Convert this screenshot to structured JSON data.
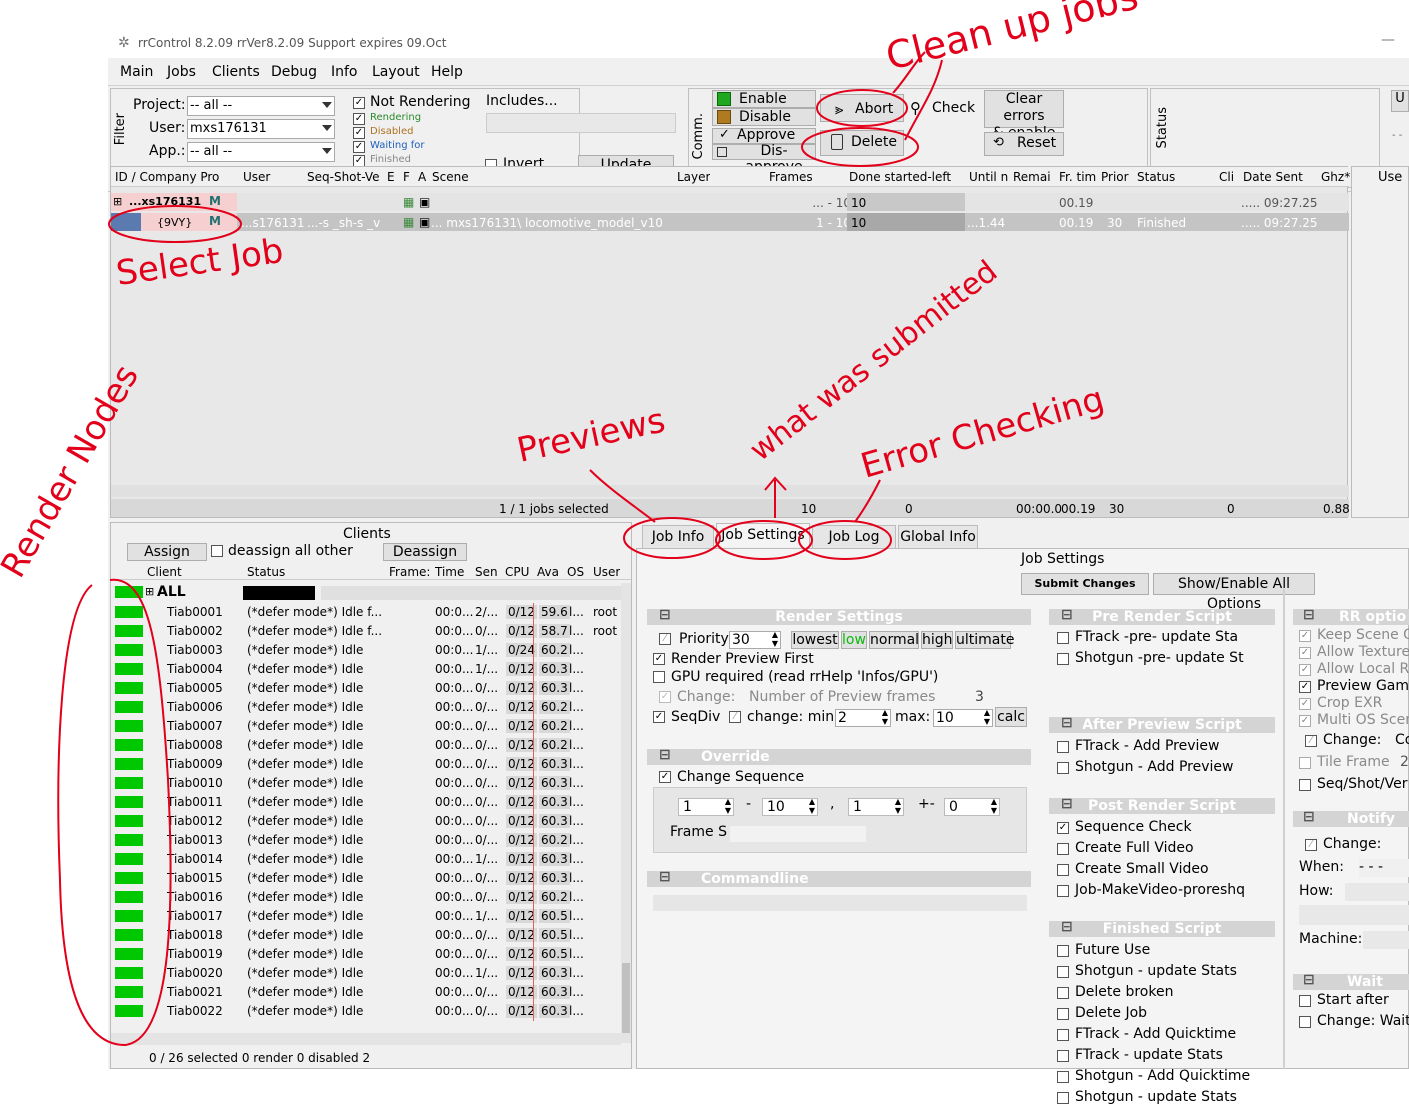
{
  "window": {
    "title": "rrControl 8.2.09    rrVer8.2.09    Support expires 09.Oct",
    "minimize": "—"
  },
  "menu": [
    "Main",
    "Jobs",
    "Clients",
    "Debug",
    "Info",
    "Layout",
    "Help"
  ],
  "filter": {
    "tab_label": "Filter",
    "project_label": "Project:",
    "project_value": "-- all --",
    "user_label": "User:",
    "user_value": "mxs176131",
    "app_label": "App.:",
    "app_value": "-- all --",
    "states": [
      "Not Rendering",
      "Rendering",
      "Disabled",
      "Waiting for",
      "Finished"
    ],
    "includes_label": "Includes...",
    "invert_label": "Invert",
    "update_label": "Update"
  },
  "commands": {
    "tab_label": "Comm.",
    "enable": "Enable",
    "disable": "Disable",
    "approve": "Approve",
    "disapprove": "Dis-approve",
    "abort": "Abort",
    "delete": "Delete",
    "check": "Check",
    "clear_errors": "Clear errors",
    "and_enable": "& enable",
    "reset": "Reset",
    "status_tab": "Status",
    "right_u": "U",
    "right_dots": "- -"
  },
  "jobs_table": {
    "headers": [
      "ID / Company Pro",
      "User",
      "Seq-Shot-Ve",
      "E",
      "F",
      "A",
      "Scene",
      "Layer",
      "Frames",
      "Done started-left",
      "Until n",
      "Remai",
      "Fr. tim",
      "Prior",
      "Status",
      "Cli",
      "Date Sent",
      "Ghz*"
    ],
    "right_header": "Use",
    "rows": [
      {
        "id": "...xs176131",
        "user": "",
        "seq": "",
        "scene": "",
        "frames": "... -   10",
        "done": "10",
        "until": "",
        "remain": "",
        "frtime": "00.19",
        "prior": "",
        "status": "",
        "date": "..... 09:27.25"
      },
      {
        "id": "{9VY}",
        "user": "...s176131",
        "seq": "...-s _sh-s _v",
        "scene": "...    mxs176131\\    locomotive_model_v10",
        "frames": "1 -   10",
        "done": "10",
        "until": "...1.44",
        "remain": "",
        "frtime": "00.19",
        "prior": "30",
        "status": "Finished",
        "date": "..... 09:27.25"
      }
    ],
    "footer": {
      "selected": "1 / 1 jobs selected",
      "frames": "10",
      "done": "0",
      "until": "00:00.0",
      "frtime": "00.19",
      "prior": "30",
      "cli": "0",
      "ghz": "0.88"
    }
  },
  "clients": {
    "title": "Clients",
    "assign": "Assign",
    "deassign_all": "deassign all other",
    "deassign": "Deassign",
    "headers": [
      "Client",
      "Status",
      "Frame:",
      "Time",
      "Sen",
      "CPU",
      "Ava",
      "OS",
      "User"
    ],
    "all_label": "ALL",
    "rows": [
      {
        "name": "Tiab0001",
        "status": "(*defer mode*)  Idle f...",
        "time": "00:0...",
        "sen": "2/...",
        "cpu": "0/12",
        "ava": "59.6",
        "os": "l...",
        "user": "root"
      },
      {
        "name": "Tiab0002",
        "status": "(*defer mode*)  Idle f...",
        "time": "00:0...",
        "sen": "0/...",
        "cpu": "0/12",
        "ava": "58.7",
        "os": "l...",
        "user": "root"
      },
      {
        "name": "Tiab0003",
        "status": "(*defer mode*)  Idle",
        "time": "00:0...",
        "sen": "1/...",
        "cpu": "0/24",
        "ava": "60.2",
        "os": "l...",
        "user": ""
      },
      {
        "name": "Tiab0004",
        "status": "(*defer mode*)  Idle",
        "time": "00:0...",
        "sen": "1/...",
        "cpu": "0/12",
        "ava": "60.3",
        "os": "l...",
        "user": ""
      },
      {
        "name": "Tiab0005",
        "status": "(*defer mode*)  Idle",
        "time": "00:0...",
        "sen": "0/...",
        "cpu": "0/12",
        "ava": "60.3",
        "os": "l...",
        "user": ""
      },
      {
        "name": "Tiab0006",
        "status": "(*defer mode*)  Idle",
        "time": "00:0...",
        "sen": "0/...",
        "cpu": "0/12",
        "ava": "60.2",
        "os": "l...",
        "user": ""
      },
      {
        "name": "Tiab0007",
        "status": "(*defer mode*)  Idle",
        "time": "00:0...",
        "sen": "0/...",
        "cpu": "0/12",
        "ava": "60.2",
        "os": "l...",
        "user": ""
      },
      {
        "name": "Tiab0008",
        "status": "(*defer mode*)  Idle",
        "time": "00:0...",
        "sen": "0/...",
        "cpu": "0/12",
        "ava": "60.2",
        "os": "l...",
        "user": ""
      },
      {
        "name": "Tiab0009",
        "status": "(*defer mode*)  Idle",
        "time": "00:0...",
        "sen": "0/...",
        "cpu": "0/12",
        "ava": "60.3",
        "os": "l...",
        "user": ""
      },
      {
        "name": "Tiab0010",
        "status": "(*defer mode*)  Idle",
        "time": "00:0...",
        "sen": "0/...",
        "cpu": "0/12",
        "ava": "60.3",
        "os": "l...",
        "user": ""
      },
      {
        "name": "Tiab0011",
        "status": "(*defer mode*)  Idle",
        "time": "00:0...",
        "sen": "0/...",
        "cpu": "0/12",
        "ava": "60.3",
        "os": "l...",
        "user": ""
      },
      {
        "name": "Tiab0012",
        "status": "(*defer mode*)  Idle",
        "time": "00:0...",
        "sen": "0/...",
        "cpu": "0/12",
        "ava": "60.3",
        "os": "l...",
        "user": ""
      },
      {
        "name": "Tiab0013",
        "status": "(*defer mode*)  Idle",
        "time": "00:0...",
        "sen": "0/...",
        "cpu": "0/12",
        "ava": "60.2",
        "os": "l...",
        "user": ""
      },
      {
        "name": "Tiab0014",
        "status": "(*defer mode*)  Idle",
        "time": "00:0...",
        "sen": "1/...",
        "cpu": "0/12",
        "ava": "60.3",
        "os": "l...",
        "user": ""
      },
      {
        "name": "Tiab0015",
        "status": "(*defer mode*)  Idle",
        "time": "00:0...",
        "sen": "0/...",
        "cpu": "0/12",
        "ava": "60.3",
        "os": "l...",
        "user": ""
      },
      {
        "name": "Tiab0016",
        "status": "(*defer mode*)  Idle",
        "time": "00:0...",
        "sen": "0/...",
        "cpu": "0/12",
        "ava": "60.2",
        "os": "l...",
        "user": ""
      },
      {
        "name": "Tiab0017",
        "status": "(*defer mode*)  Idle",
        "time": "00:0...",
        "sen": "1/...",
        "cpu": "0/12",
        "ava": "60.5",
        "os": "l...",
        "user": ""
      },
      {
        "name": "Tiab0018",
        "status": "(*defer mode*)  Idle",
        "time": "00:0...",
        "sen": "0/...",
        "cpu": "0/12",
        "ava": "60.5",
        "os": "l...",
        "user": ""
      },
      {
        "name": "Tiab0019",
        "status": "(*defer mode*)  Idle",
        "time": "00:0...",
        "sen": "0/...",
        "cpu": "0/12",
        "ava": "60.5",
        "os": "l...",
        "user": ""
      },
      {
        "name": "Tiab0020",
        "status": "(*defer mode*)  Idle",
        "time": "00:0...",
        "sen": "1/...",
        "cpu": "0/12",
        "ava": "60.3",
        "os": "l...",
        "user": ""
      },
      {
        "name": "Tiab0021",
        "status": "(*defer mode*)  Idle",
        "time": "00:0...",
        "sen": "0/...",
        "cpu": "0/12",
        "ava": "60.3",
        "os": "l...",
        "user": ""
      },
      {
        "name": "Tiab0022",
        "status": "(*defer mode*)  Idle",
        "time": "00:0...",
        "sen": "0/...",
        "cpu": "0/12",
        "ava": "60.3",
        "os": "l...",
        "user": ""
      }
    ],
    "footer": "0 / 26 selected    0 render   0 disabled  2"
  },
  "tabs": [
    "Job Info",
    "Job Settings",
    "Job Log",
    "Global Info"
  ],
  "settings": {
    "title": "Job Settings",
    "submit": "Submit Changes",
    "show_all": "Show/Enable All Options",
    "render": {
      "header": "Render Settings",
      "priority_label": "Priority",
      "priority_value": "30",
      "levels": [
        "lowest",
        "low",
        "normal",
        "high",
        "ultimate"
      ],
      "preview_first": "Render Preview First",
      "gpu": "GPU required (read rrHelp 'Infos/GPU')",
      "change": "Change:",
      "num_preview": "Number of Preview frames",
      "num_preview_value": "3",
      "seqdiv": "SeqDiv",
      "change_min": "change:  min:",
      "min_value": "2",
      "max_label": "max:",
      "max_value": "10",
      "calc": "calc"
    },
    "override": {
      "header": "Override",
      "change_seq": "Change Sequence",
      "start": "1",
      "end": "10",
      "step": "1",
      "offset": "0",
      "dash": "-",
      "comma": ",",
      "plusminus": "+-",
      "frame_label": "Frame S"
    },
    "commandline": {
      "header": "Commandline"
    },
    "pre_render": {
      "header": "Pre Render Script",
      "items": [
        "FTrack -pre- update Sta",
        "Shotgun -pre- update St"
      ]
    },
    "after_preview": {
      "header": "After Preview Script",
      "items": [
        "FTrack - Add Preview",
        "Shotgun - Add Preview"
      ]
    },
    "post_render": {
      "header": "Post Render Script",
      "items": [
        "Sequence Check",
        "Create Full Video",
        "Create Small Video",
        "Job-MakeVideo-proreshq"
      ]
    },
    "finished": {
      "header": "Finished Script",
      "items": [
        "Future Use",
        "Shotgun - update Stats",
        "Delete broken",
        "Delete Job",
        "FTrack - Add Quicktime",
        "FTrack - update Stats",
        "Shotgun - Add Quicktime",
        "Shotgun - update Stats"
      ]
    },
    "rr_options": {
      "header": "RR optio",
      "items": [
        "Keep Scene O",
        "Allow Texture R",
        "Allow Local Ren",
        "Preview Gamm",
        "Crop EXR",
        "Multi OS Scene"
      ],
      "change": "Change:",
      "change_val": "Co",
      "tile": "Tile Frame",
      "tile_val": "2",
      "seqshot": "Seq/Shot/Ver"
    },
    "notify": {
      "header": "Notify",
      "change": "Change:",
      "when": "When:",
      "when_val": "- - -",
      "how": "How:",
      "machine": "Machine:"
    },
    "wait": {
      "header": "Wait",
      "start_after": "Start after",
      "change_wait": "Change: Wait f"
    }
  },
  "annotations": {
    "clean_up": "Clean up jobs",
    "select_job": "Select Job",
    "render_nodes": "Render Nodes",
    "previews": "Previews",
    "what_submitted": "what was submitted",
    "error_checking": "Error Checking"
  }
}
